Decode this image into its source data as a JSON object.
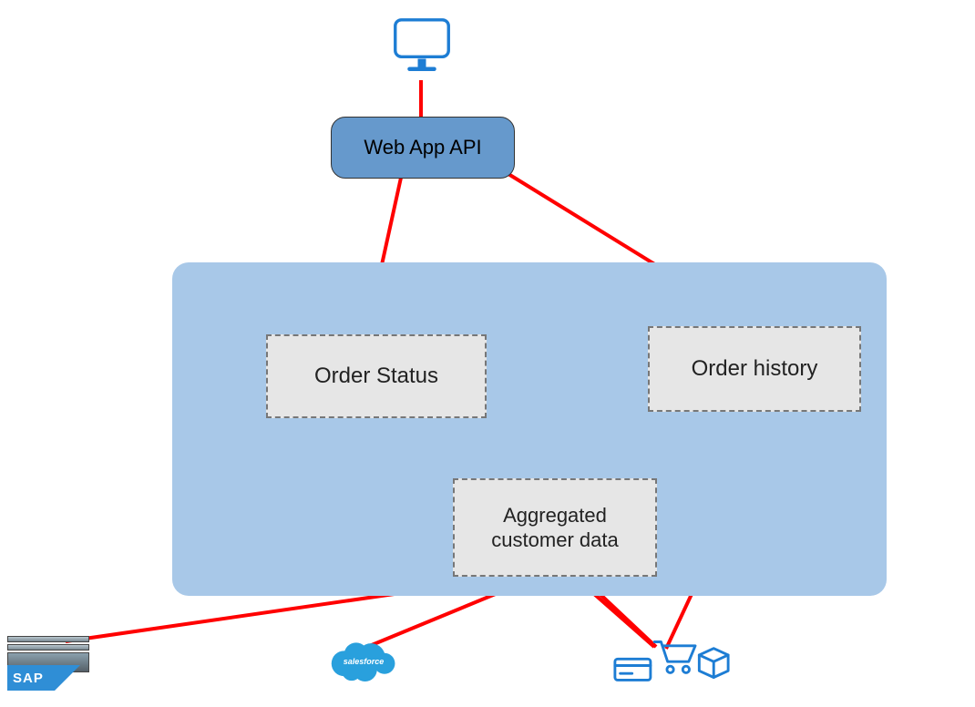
{
  "nodes": {
    "web_app_api": "Web App API",
    "order_status": "Order Status",
    "order_history": "Order history",
    "aggregated": "Aggregated\ncustomer data"
  },
  "icons": {
    "monitor": "monitor-icon",
    "sap": "SAP",
    "salesforce": "salesforce",
    "ecommerce": "ecommerce-icons"
  },
  "colors": {
    "connector": "#ff0000",
    "container_bg": "#a8c8e8",
    "api_bg": "#6699cc",
    "dashed_bg": "#e6e6e6",
    "icon_blue": "#1d7dd4"
  }
}
